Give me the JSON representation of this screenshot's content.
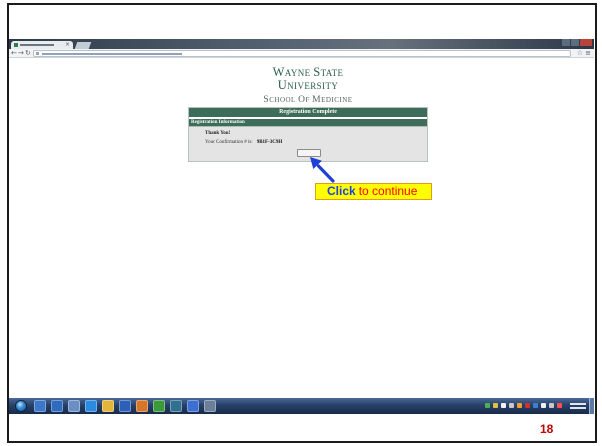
{
  "slide": {
    "number": "18"
  },
  "browser": {
    "icons": {
      "tab_close": "×",
      "back": "←",
      "forward": "→",
      "reload": "↻",
      "star": "☆",
      "menu": "≡"
    }
  },
  "page": {
    "logo": {
      "line1": [
        "WAYNE",
        "STATE"
      ],
      "line2": [
        "UNIVERSITY"
      ],
      "line3": [
        "SCHOOL",
        "OF",
        "MEDICINE"
      ]
    },
    "panel": {
      "title": "Registration Complete",
      "section": "Registration Information",
      "thank_you": "Thank You!",
      "confirmation_label": "Your Confirmation # is:",
      "confirmation_number": "9B1F-3C9H"
    }
  },
  "callout": {
    "click": "Click",
    "rest": "to continue"
  },
  "taskbar": {
    "apps": [
      {
        "icon": "explorer-icon",
        "color": "#3b78c8"
      },
      {
        "icon": "blue-app-icon",
        "color": "#2f6cc0"
      },
      {
        "icon": "media-app-icon",
        "color": "#6a8fc4"
      },
      {
        "icon": "internet-explorer-icon",
        "color": "#2a8be0"
      },
      {
        "icon": "folder-icon",
        "color": "#e2b43a"
      },
      {
        "icon": "blue-document-app-icon",
        "color": "#2d5fb8"
      },
      {
        "icon": "orange-app-icon",
        "color": "#d5762a"
      },
      {
        "icon": "green-app-icon",
        "color": "#3c9a3c"
      },
      {
        "icon": "teal-app-icon",
        "color": "#2f6f8f"
      },
      {
        "icon": "blue-browser-icon",
        "color": "#3b6fd1"
      },
      {
        "icon": "gray-app-icon",
        "color": "#6b7f99"
      }
    ],
    "tray": [
      {
        "icon": "green-tray-icon",
        "color": "#4caf50"
      },
      {
        "icon": "yellow-tray-icon",
        "color": "#e0c040"
      },
      {
        "icon": "white-tray-icon",
        "color": "#f2f2f2"
      },
      {
        "icon": "gray-tray-icon",
        "color": "#c9c9c9"
      },
      {
        "icon": "orange-tray-icon",
        "color": "#f0a030"
      },
      {
        "icon": "red-tray-icon",
        "color": "#d03030"
      },
      {
        "icon": "blue-tray-icon",
        "color": "#3f7fd0"
      },
      {
        "icon": "flag-tray-icon",
        "color": "#f0f0f0"
      },
      {
        "icon": "network-tray-icon",
        "color": "#c8c8c8"
      },
      {
        "icon": "volume-tray-icon",
        "color": "#ff5050"
      }
    ]
  },
  "colors": {
    "green": "#3d6c5a",
    "logo_green": "#2b5e4b",
    "logo_gray": "#55645d",
    "panel_gray": "#e4e4e4",
    "accent_green": "#2e7d4f",
    "slide_number": "#c00000",
    "callout_fill": "#ffff00",
    "callout_border": "#e39b1b",
    "click_color": "#1f3fe0",
    "rest_color": "#ff0000",
    "arrow": "#1f3fd6"
  }
}
